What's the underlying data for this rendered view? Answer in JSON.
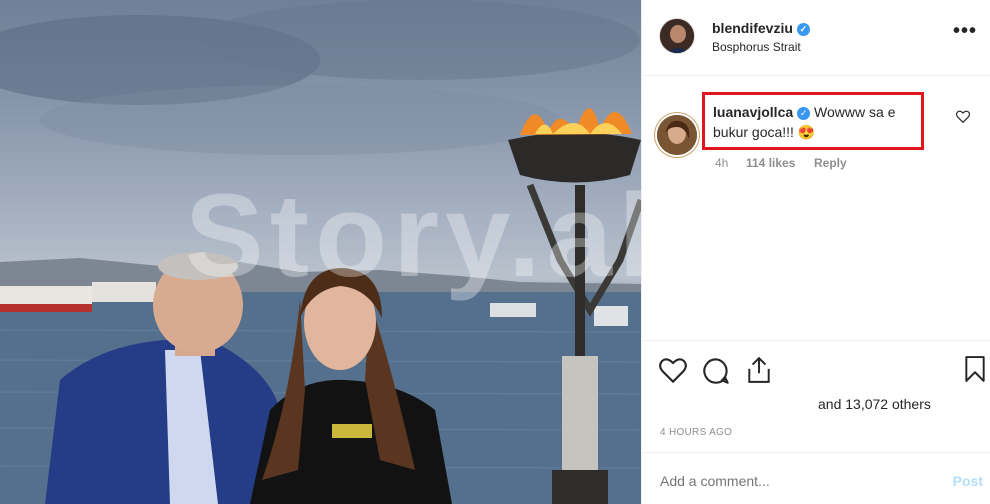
{
  "photo": {
    "watermark": "Story.al"
  },
  "header": {
    "username": "blendifevziu",
    "verified_mark": "✓",
    "location": "Bosphorus Strait",
    "more_label": "•••"
  },
  "comment": {
    "username": "luanavjollca",
    "text": "Wowww sa e bukur goca!!! 😍",
    "age": "4h",
    "likes": "114 likes",
    "reply": "Reply"
  },
  "post": {
    "likes_text": "and 13,072 others",
    "timestamp": "4 HOURS AGO",
    "add_comment_placeholder": "Add a comment...",
    "post_label": "Post"
  },
  "icons": {
    "heart": "heart-icon",
    "comment": "comment-icon",
    "share": "share-icon",
    "bookmark": "bookmark-icon"
  },
  "colors": {
    "highlight_border": "#e0161e",
    "verified_blue": "#3897f0",
    "post_button_disabled": "#b2dffc"
  }
}
